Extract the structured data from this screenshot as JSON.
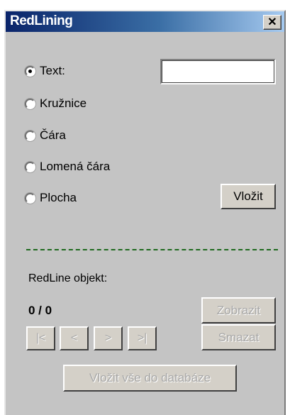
{
  "window": {
    "title": "RedLining",
    "close_glyph": "✕"
  },
  "radios": [
    {
      "label": "Text:",
      "selected": true
    },
    {
      "label": "Kružnice",
      "selected": false
    },
    {
      "label": "Čára",
      "selected": false
    },
    {
      "label": "Lomená čára",
      "selected": false
    },
    {
      "label": "Plocha",
      "selected": false
    }
  ],
  "text_input": {
    "value": ""
  },
  "insert_button": {
    "label": "Vložit"
  },
  "redline": {
    "heading": "RedLine objekt:",
    "counter": "0 / 0",
    "show_label": "Zobrazit",
    "delete_label": "Smazat",
    "nav": {
      "first": "|<",
      "prev": "<",
      "next": ">",
      "last": ">|"
    },
    "insert_all_label": "Vložit vše do databáze"
  },
  "colors": {
    "title_start": "#0a246a",
    "title_end": "#a6caf0",
    "panel": "#c4c4c4",
    "divider": "#1f6a1f"
  }
}
